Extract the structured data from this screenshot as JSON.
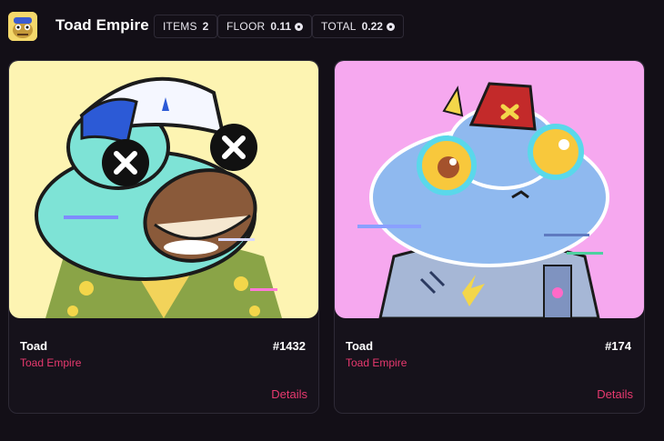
{
  "collection": {
    "name": "Toad Empire",
    "avatar_icon": "toad-avatar-icon"
  },
  "stats": {
    "items_label": "ITEMS",
    "items_value": "2",
    "floor_label": "FLOOR",
    "floor_value": "0.11",
    "total_label": "TOTAL",
    "total_value": "0.22",
    "currency_icon": "coin-icon"
  },
  "cards": [
    {
      "name": "Toad",
      "collection": "Toad Empire",
      "number": "#1432",
      "details_label": "Details",
      "background_color": "#fdf4b2"
    },
    {
      "name": "Toad",
      "collection": "Toad Empire",
      "number": "#174",
      "details_label": "Details",
      "background_color": "#f6a8ef"
    }
  ],
  "colors": {
    "page_background": "#130f17",
    "accent": "#e8396f",
    "border": "#2e2a36"
  }
}
